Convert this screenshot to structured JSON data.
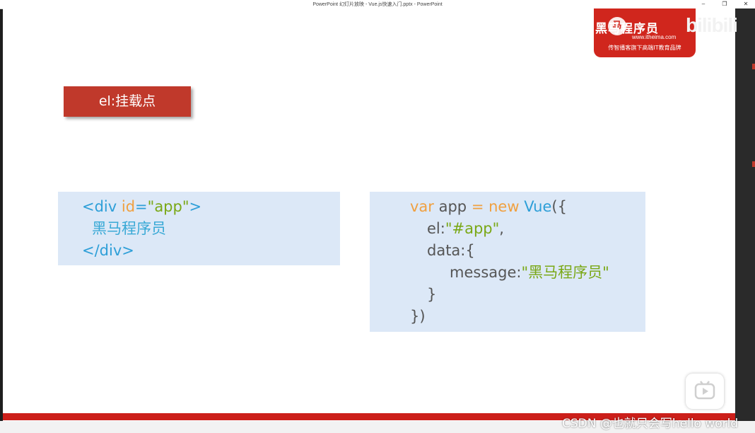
{
  "window": {
    "title": "PowerPoint 幻灯片放映 - Vue.js快速入门.pptx - PowerPoint",
    "controls": [
      "–",
      "❐",
      "✕"
    ]
  },
  "logo": {
    "brand": "黑马程序员",
    "site": "www.itheima.com",
    "slogan": "传智播客旗下高端IT教育品牌",
    "badge": "马"
  },
  "watermark": {
    "bilibili": "bilibili",
    "csdn": "CSDN @也就只会写hello world"
  },
  "slide": {
    "section_label": "el:挂载点",
    "html_code": {
      "line1": {
        "open": "<div ",
        "attr": "id",
        "eq": "=",
        "value": "\"app\"",
        "close": ">"
      },
      "line2": "黑马程序员",
      "line3": "</div>"
    },
    "js_code": {
      "line1": {
        "kw_var": "var",
        "name": " app ",
        "eq": "=",
        "kw_new": " new ",
        "cls": "Vue",
        "tail": "({"
      },
      "line2": {
        "key": "el:",
        "value": "\"#app\"",
        "tail": ","
      },
      "line3": "data:{",
      "line4": {
        "key": "message:",
        "value": "\"黑马程序员\""
      },
      "line5": "}",
      "line6": "})"
    }
  },
  "colors": {
    "accent_red": "#c0392b",
    "code_bg": "#dce8f7",
    "tag_blue": "#2e9fd8",
    "attr_orange": "#f0a040",
    "string_green": "#7aa816"
  }
}
